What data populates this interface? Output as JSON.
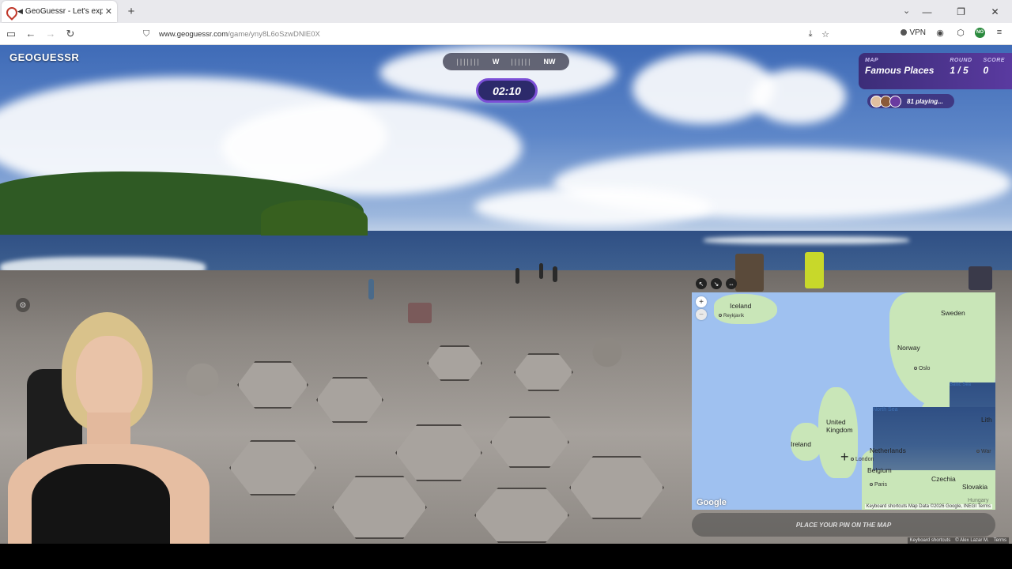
{
  "browser": {
    "tab_title": "GeoGuessr - Let's explore t",
    "url_host": "www.geoguessr.com",
    "url_path": "/game/yny8L6oSzwDNlE0X",
    "vpn_label": "VPN",
    "no_badge": "NO"
  },
  "game": {
    "logo": "GEOGUESSR",
    "compass": {
      "w": "W",
      "nw": "NW"
    },
    "timer": "02:10",
    "map_label": "MAP",
    "map_value": "Famous Places",
    "round_label": "ROUND",
    "round_value": "1 / 5",
    "score_label": "SCORE",
    "score_value": "0",
    "playing": "81 playing...",
    "place_pin": "PLACE YOUR PIN ON THE MAP",
    "footer_shortcuts": "Keyboard shortcuts",
    "footer_credit": "© Alex Lazar M.",
    "footer_terms": "Terms"
  },
  "map": {
    "labels": {
      "iceland": "Iceland",
      "reykjavik": "Reykjavík",
      "sweden": "Sweden",
      "norway": "Norway",
      "oslo": "Oslo",
      "baltic": "Baltic Sea",
      "north_sea": "North Sea",
      "uk": "United Kingdom",
      "ireland": "Ireland",
      "netherlands": "Netherlands",
      "london": "London",
      "belgium": "Belgium",
      "paris": "Paris",
      "czechia": "Czechia",
      "slovakia": "Slovakia",
      "lith": "Lith",
      "war": "War",
      "hung": "Hungary"
    },
    "zoom_in": "+",
    "zoom_out": "−",
    "google": "Google",
    "attribution": "Keyboard shortcuts   Map Data ©2026 Google, INEGI   Terms"
  },
  "colors": {
    "accent": "#5a3aa0",
    "timer_border": "#7b4fd6",
    "map_water": "#9fc1f0",
    "map_land": "#c9e6b8"
  }
}
